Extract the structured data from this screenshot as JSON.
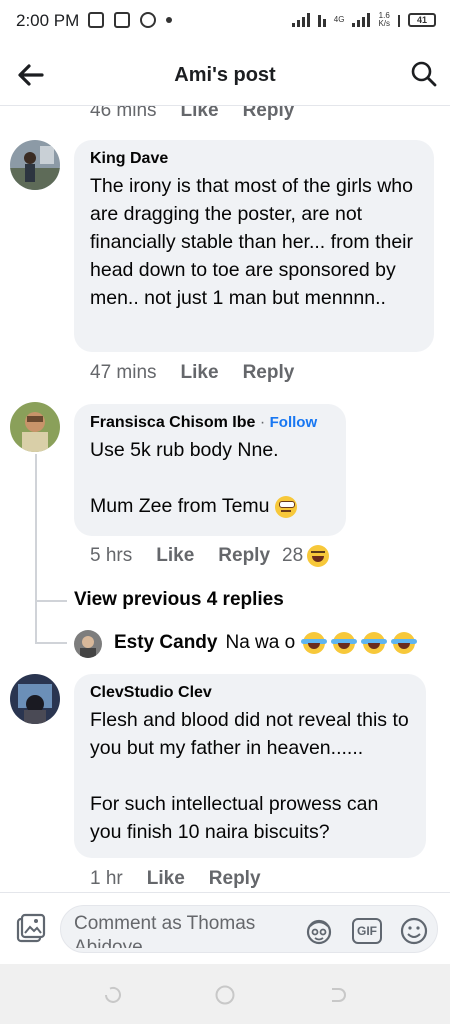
{
  "status": {
    "time": "2:00 PM",
    "net": "4G",
    "speed_value": "1.6",
    "speed_unit": "K/s",
    "battery": "41"
  },
  "header": {
    "title": "Ami's post"
  },
  "top_meta": {
    "time": "46 mins",
    "like": "Like",
    "reply": "Reply"
  },
  "comments": [
    {
      "author": "King Dave",
      "text": "The irony is that most of the girls who are dragging the poster, are not financially stable than her... from their head down to toe are sponsored by men.. not just 1 man but mennnn..",
      "time": "47 mins",
      "like": "Like",
      "reply": "Reply"
    },
    {
      "author": "Fransisca Chisom Ibe",
      "separator": "·",
      "follow": "Follow",
      "text": "Use 5k rub body Nne.\n\nMum Zee from Temu",
      "time": "5 hrs",
      "like": "Like",
      "reply": "Reply",
      "reaction_count": "28",
      "view_replies": "View previous 4 replies",
      "reply_preview": {
        "author": "Esty Candy",
        "text": "Na wa o"
      }
    },
    {
      "author": "ClevStudio Clev",
      "text": "Flesh and blood did not reveal this to you but my father in heaven......\n\nFor such intellectual prowess can you finish 10 naira biscuits?",
      "time": "1 hr",
      "like": "Like",
      "reply": "Reply"
    }
  ],
  "composer": {
    "placeholder": "Comment as Thomas Abidoye",
    "gif": "GIF"
  }
}
